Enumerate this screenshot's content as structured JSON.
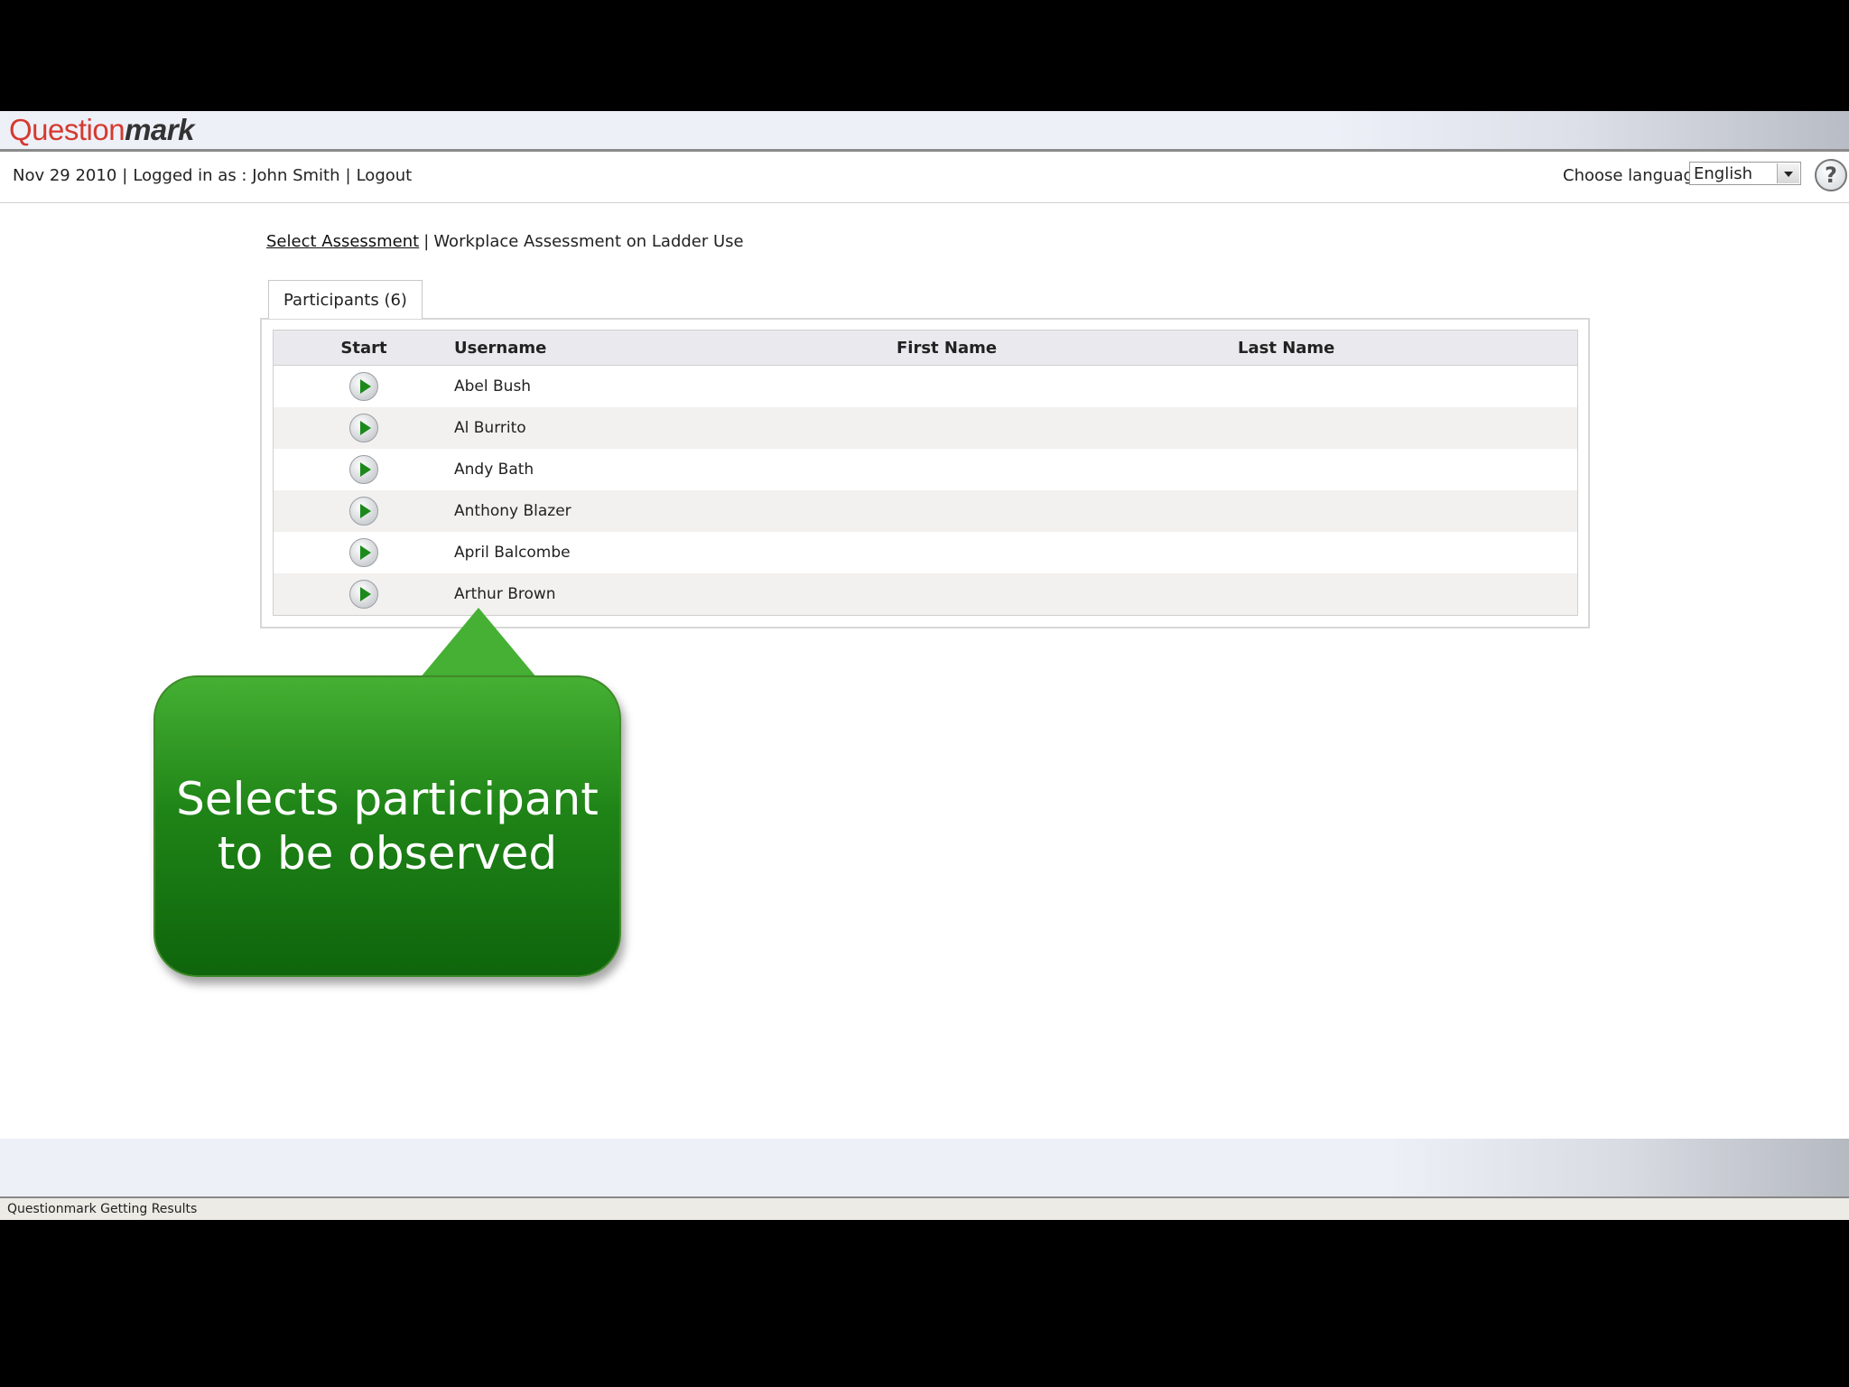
{
  "app": {
    "logo_question": "Question",
    "logo_mark": "mark"
  },
  "header": {
    "date": "Nov 29 2010",
    "logged_in_label": "Logged in as : John Smith",
    "logout": "Logout",
    "separator": "|",
    "language_label": "Choose language",
    "language_value": "English",
    "help_icon": "help-icon"
  },
  "breadcrumb": {
    "link": "Select Assessment",
    "separator": "|",
    "current": "Workplace Assessment on Ladder Use"
  },
  "tab": {
    "label": "Participants (6)"
  },
  "table": {
    "headers": {
      "start": "Start",
      "username": "Username",
      "first_name": "First Name",
      "last_name": "Last Name"
    },
    "rows": [
      {
        "username": "Abel Bush",
        "first_name": "",
        "last_name": ""
      },
      {
        "username": "Al Burrito",
        "first_name": "",
        "last_name": ""
      },
      {
        "username": "Andy Bath",
        "first_name": "",
        "last_name": ""
      },
      {
        "username": "Anthony Blazer",
        "first_name": "",
        "last_name": ""
      },
      {
        "username": "April Balcombe",
        "first_name": "",
        "last_name": ""
      },
      {
        "username": "Arthur Brown",
        "first_name": "",
        "last_name": ""
      }
    ]
  },
  "callout": {
    "line1": "Selects participant",
    "line2": "to be observed"
  },
  "status": {
    "text": "Questionmark Getting Results"
  },
  "colors": {
    "accent_green": "#1f8417",
    "logo_red": "#d43a2f"
  }
}
